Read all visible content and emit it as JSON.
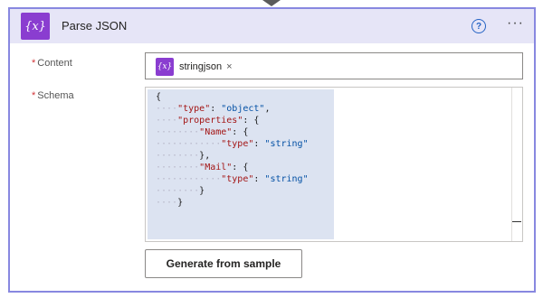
{
  "action": {
    "icon": "variable-icon",
    "icon_glyph": "{𝑥}",
    "title": "Parse JSON",
    "help_glyph": "?",
    "more_glyph": "···"
  },
  "content_field": {
    "required_marker": "*",
    "label": "Content",
    "token": {
      "icon_glyph": "{𝑥}",
      "label": "stringjson",
      "remove_glyph": "×"
    }
  },
  "schema_field": {
    "required_marker": "*",
    "label": "Schema",
    "code_lines": [
      "{",
      "····\"type\": \"object\",",
      "····\"properties\": {",
      "········\"Name\": {",
      "············\"type\": \"string\"",
      "········},",
      "········\"Mail\": {",
      "············\"type\": \"string\"",
      "········}",
      "····}"
    ]
  },
  "generate_button": {
    "label": "Generate from sample"
  },
  "colors": {
    "accent": "#8a3dd0",
    "header_bg": "#e6e5f7",
    "card_border": "#8888e0",
    "help_blue": "#2563c4"
  }
}
